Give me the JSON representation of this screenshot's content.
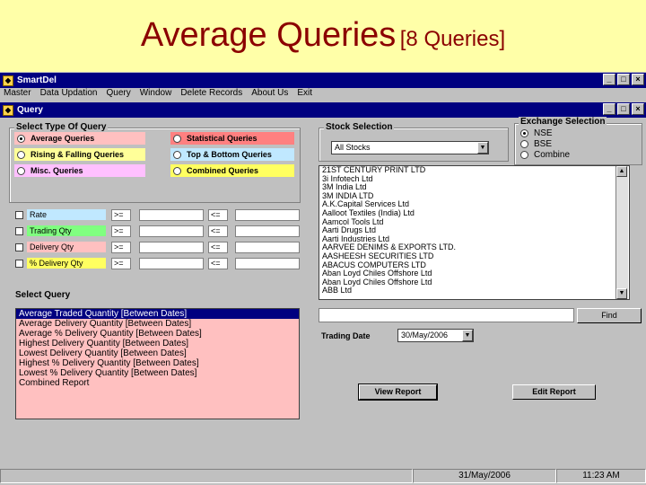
{
  "slide": {
    "title_main": "Average Queries",
    "title_sub": "[8 Queries]"
  },
  "app": {
    "title": "SmartDel",
    "menu": [
      "Master",
      "Data Updation",
      "Query",
      "Window",
      "Delete Records",
      "About Us",
      "Exit"
    ]
  },
  "query_window": {
    "title": "Query"
  },
  "query_type": {
    "group_label": "Select Type Of Query",
    "options": [
      {
        "label": "Average Queries",
        "color": "#ffc0c0",
        "selected": true
      },
      {
        "label": "Statistical Queries",
        "color": "#ff8080",
        "selected": false
      },
      {
        "label": "Rising & Falling Queries",
        "color": "#ffff99",
        "selected": false
      },
      {
        "label": "Top & Bottom Queries",
        "color": "#c0e8ff",
        "selected": false
      },
      {
        "label": "Misc. Queries",
        "color": "#ffc0ff",
        "selected": false
      },
      {
        "label": "Combined Queries",
        "color": "#ffff60",
        "selected": false
      }
    ]
  },
  "filters": [
    {
      "label": "Rate",
      "color": "#c0e8ff",
      "op1": ">=",
      "op2": "<="
    },
    {
      "label": "Trading Qty",
      "color": "#80ff80",
      "op1": ">=",
      "op2": "<="
    },
    {
      "label": "Delivery Qty",
      "color": "#ffc0c0",
      "op1": ">=",
      "op2": "<="
    },
    {
      "label": "% Delivery Qty",
      "color": "#ffff60",
      "op1": ">=",
      "op2": "<="
    }
  ],
  "select_query": {
    "label": "Select Query",
    "items": [
      "Average Traded Quantity [Between Dates]",
      "Average Delivery Quantity [Between Dates]",
      "Average % Delivery Quantity [Between Dates]",
      "Highest Delivery Quantity [Between Dates]",
      "Lowest Delivery Quantity [Between Dates]",
      "Highest % Delivery Quantity [Between Dates]",
      "Lowest % Delivery Quantity [Between Dates]",
      "Combined Report"
    ],
    "selected_index": 0
  },
  "stock_selection": {
    "group_label": "Stock Selection",
    "combo_value": "All Stocks",
    "stocks": [
      "21ST CENTURY PRINT LTD",
      "3i Infotech Ltd",
      "3M India Ltd",
      "3M INDIA LTD",
      "A.K.Capital Services Ltd",
      "Aalloot Textiles (India) Ltd",
      "Aamcol Tools Ltd",
      "Aarti Drugs Ltd",
      "Aarti Industries Ltd",
      "AARVEE DENIMS & EXPORTS LTD.",
      "AASHEESH SECURITIES LTD",
      "ABACUS COMPUTERS LTD",
      "Aban Loyd Chiles Offshore Ltd",
      "Aban Loyd Chiles Offshore Ltd",
      "ABB Ltd"
    ]
  },
  "exchange": {
    "group_label": "Exchange Selection",
    "options": [
      {
        "label": "NSE",
        "selected": true
      },
      {
        "label": "BSE",
        "selected": false
      },
      {
        "label": "Combine",
        "selected": false
      }
    ]
  },
  "find": {
    "button_label": "Find",
    "value": ""
  },
  "trading_date": {
    "label": "Trading Date",
    "value": "30/May/2006"
  },
  "buttons": {
    "view_report": "View Report",
    "edit_report": "Edit Report"
  },
  "status": {
    "date": "31/May/2006",
    "time": "11:23 AM"
  }
}
